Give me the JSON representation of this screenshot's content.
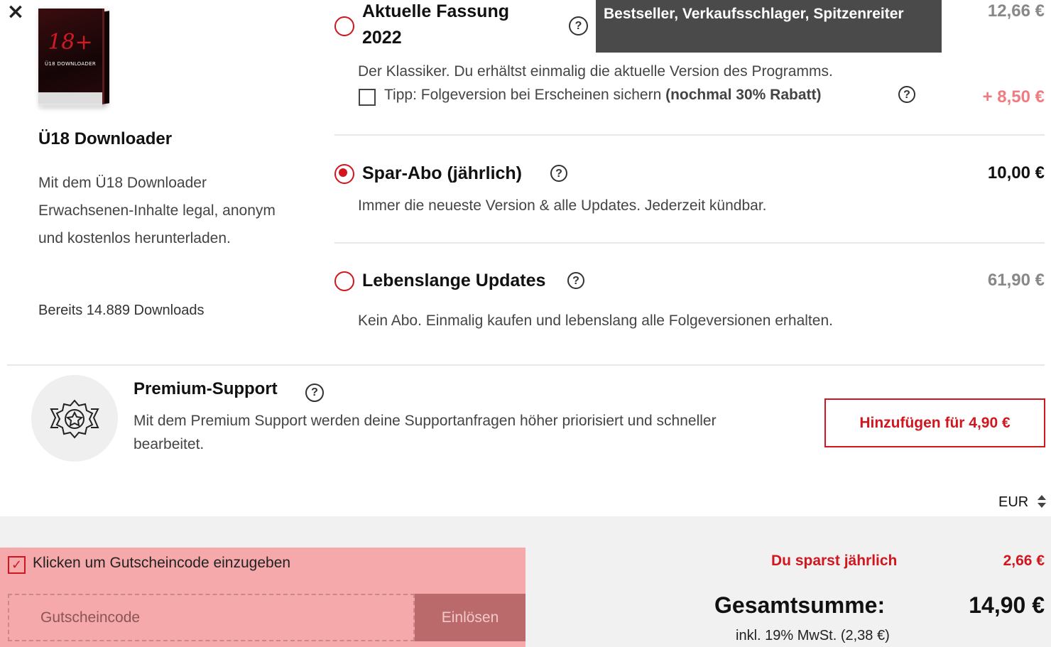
{
  "close_label": "×",
  "product": {
    "box_logo": "18+",
    "box_name": "Ü18 DOWNLOADER",
    "title": "Ü18 Downloader",
    "description": "Mit dem Ü18 Downloader Erwachsenen-Inhalte legal, anonym und kostenlos herunterladen.",
    "downloads": "Bereits 14.889 Downloads"
  },
  "options": [
    {
      "title_line1": "Aktuelle Fassung",
      "title_line2": "2022",
      "price": "12,66 €",
      "description": "Der Klassiker. Du erhältst einmalig die aktuelle Version des Programms.",
      "tip_text": "Tipp: Folgeversion bei Erscheinen sichern",
      "tip_bold": "(nochmal 30% Rabatt)",
      "tip_price": "+ 8,50 €",
      "selected": false
    },
    {
      "title": "Spar-Abo (jährlich)",
      "price": "10,00 €",
      "description": "Immer die neueste Version & alle Updates. Jederzeit kündbar.",
      "selected": true
    },
    {
      "title": "Lebenslange Updates",
      "price": "61,90 €",
      "description": "Kein Abo. Einmalig kaufen und lebenslang alle Folgeversionen erhalten.",
      "selected": false
    }
  ],
  "tooltip": "Bestseller, Verkaufsschlager, Spitzenreiter",
  "help_icon": "?",
  "premium": {
    "title": "Premium-Support",
    "description": "Mit dem Premium Support werden deine Supportanfragen höher priorisiert und schneller bearbeitet.",
    "button": "Hinzufügen für 4,90 €",
    "icon": "award-badge-icon"
  },
  "currency": "EUR",
  "coupon": {
    "label": "Klicken um Gutscheincode einzugeben",
    "placeholder": "Gutscheincode",
    "button": "Einlösen",
    "checked": true
  },
  "summary": {
    "save_label": "Du sparst jährlich",
    "save_value": "2,66 €",
    "total_label": "Gesamtsumme:",
    "total_value": "14,90 €",
    "vat": "inkl. 19% MwSt. (2,38 €)"
  },
  "colors": {
    "accent": "#d0161f",
    "coupon_highlight": "#f5a9aa",
    "tooltip_bg": "#4a4a4a"
  }
}
